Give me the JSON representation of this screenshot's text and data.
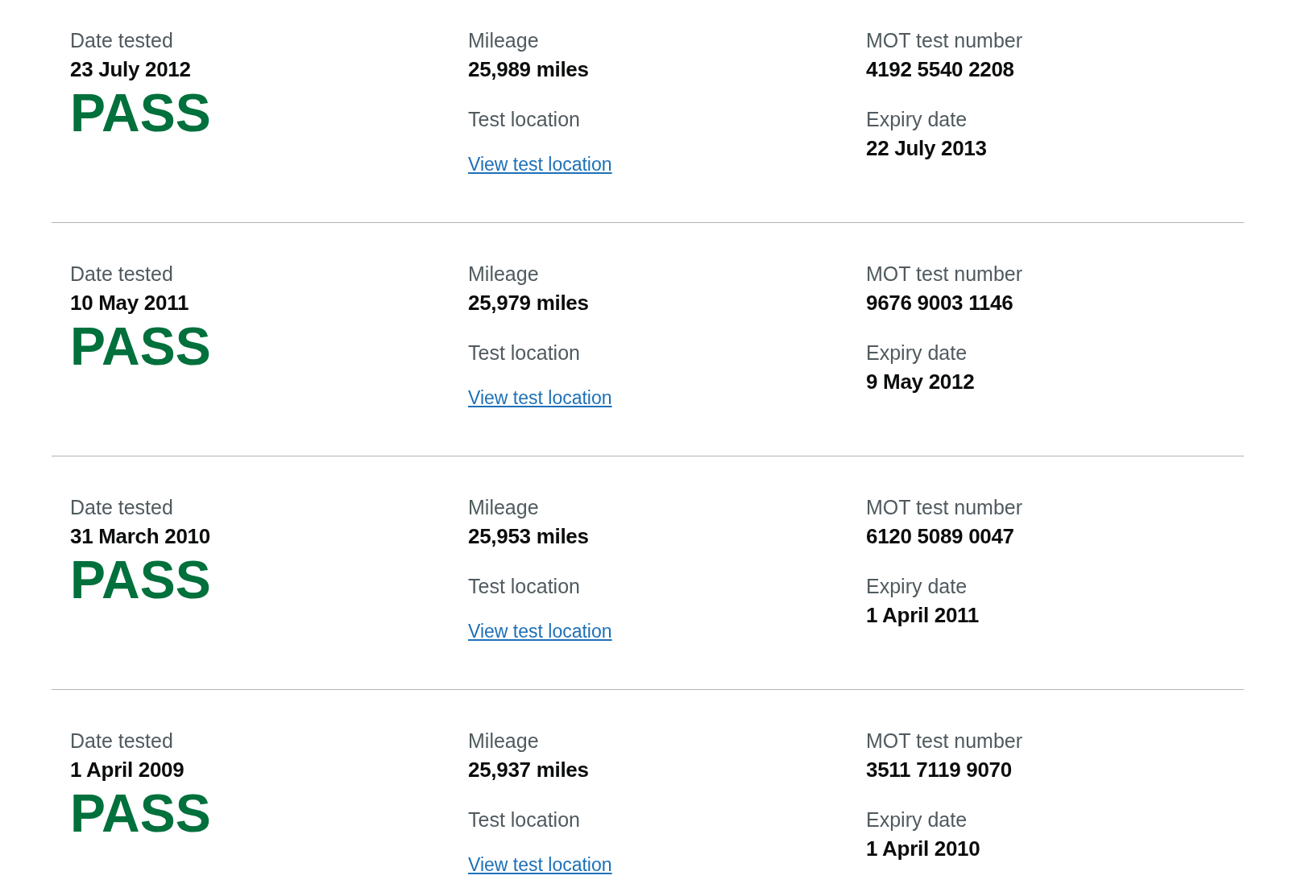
{
  "tests": [
    {
      "date_label": "Date tested",
      "date": "23 July 2012",
      "result": "PASS",
      "kind": "pass",
      "mileage_label": "Mileage",
      "mileage": "25,989 miles",
      "location_label": "Test location",
      "location_link": "View test location",
      "number_label": "MOT test number",
      "number": "4192 5540 2208",
      "expiry_label": "Expiry date",
      "expiry": "22 July 2013"
    },
    {
      "date_label": "Date tested",
      "date": "10 May 2011",
      "result": "PASS",
      "kind": "pass",
      "mileage_label": "Mileage",
      "mileage": "25,979 miles",
      "location_label": "Test location",
      "location_link": "View test location",
      "number_label": "MOT test number",
      "number": "9676 9003 1146",
      "expiry_label": "Expiry date",
      "expiry": "9 May 2012"
    },
    {
      "date_label": "Date tested",
      "date": "31 March 2010",
      "result": "PASS",
      "kind": "pass",
      "mileage_label": "Mileage",
      "mileage": "25,953 miles",
      "location_label": "Test location",
      "location_link": "View test location",
      "number_label": "MOT test number",
      "number": "6120 5089 0047",
      "expiry_label": "Expiry date",
      "expiry": "1 April 2011"
    },
    {
      "date_label": "Date tested",
      "date": "1 April 2009",
      "result": "PASS",
      "kind": "pass",
      "mileage_label": "Mileage",
      "mileage": "25,937 miles",
      "location_label": "Test location",
      "location_link": "View test location",
      "number_label": "MOT test number",
      "number": "3511 7119 9070",
      "expiry_label": "Expiry date",
      "expiry": "1 April 2010"
    }
  ]
}
